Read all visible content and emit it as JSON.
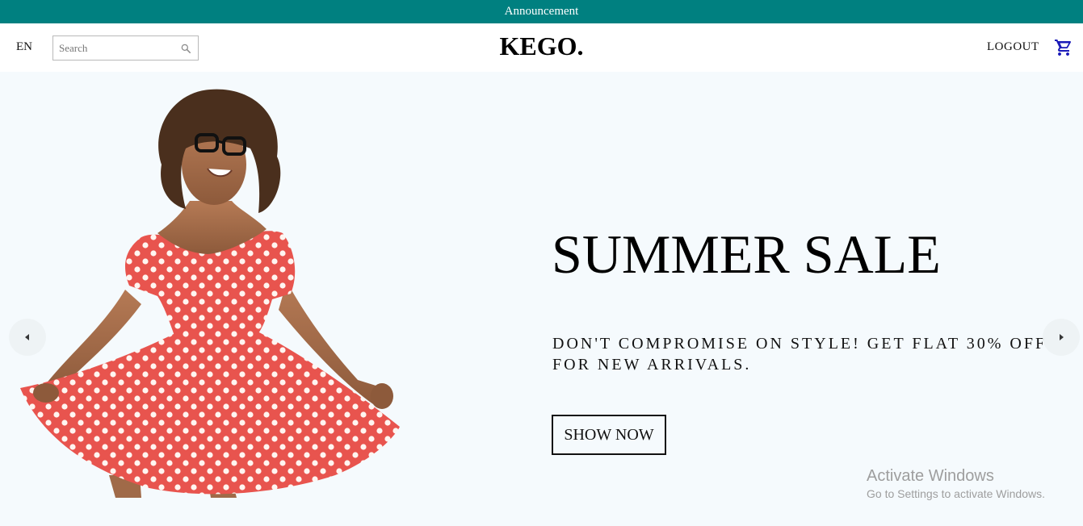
{
  "announcement": {
    "text": "Announcement"
  },
  "navbar": {
    "language": "EN",
    "search": {
      "placeholder": "Search",
      "value": ""
    },
    "logo": "KEGO.",
    "logout_label": "LOGOUT",
    "cart_icon": "shopping-cart-icon"
  },
  "slide": {
    "title": "SUMMER SALE",
    "description": "DON'T COMPROMISE ON STYLE! GET FLAT 30% OFF FOR NEW ARRIVALS.",
    "button_label": "SHOW NOW",
    "background_color": "#f5fafd",
    "image_subject": "woman in red polka dot dress"
  },
  "colors": {
    "announcement_bg": "#008080",
    "cart_icon": "#1a1ab8"
  },
  "watermark": {
    "line1": "Activate Windows",
    "line2": "Go to Settings to activate Windows."
  }
}
